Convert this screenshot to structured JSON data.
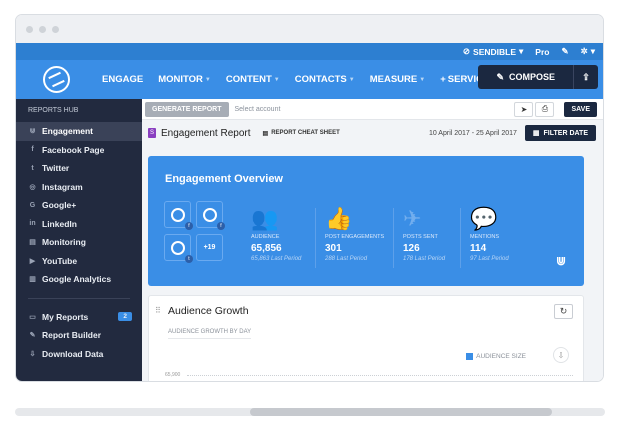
{
  "topbar": {
    "brand": "SENDIBLE",
    "plan": "Pro"
  },
  "nav": {
    "menu": [
      "ENGAGE",
      "MONITOR",
      "CONTENT",
      "CONTACTS",
      "MEASURE",
      "SERVICES"
    ],
    "compose_label": "COMPOSE"
  },
  "sidebar": {
    "heading": "REPORTS HUB",
    "items": [
      "Engagement",
      "Facebook Page",
      "Twitter",
      "Instagram",
      "Google+",
      "LinkedIn",
      "Monitoring",
      "YouTube",
      "Google Analytics"
    ],
    "bottom_items": [
      "My Reports",
      "Report Builder",
      "Download Data"
    ],
    "my_reports_count": "2"
  },
  "reportbar": {
    "generate_label": "GENERATE REPORT",
    "account_placeholder": "Select account",
    "save_label": "SAVE"
  },
  "report": {
    "title": "Engagement Report",
    "cheat_sheet": "REPORT CHEAT SHEET",
    "date_range": "10 April 2017 - 25 April 2017",
    "filter_label": "FILTER DATE"
  },
  "overview": {
    "title": "Engagement Overview",
    "more_accounts": "+19",
    "stats": [
      {
        "label": "AUDIENCE",
        "value": "65,856",
        "last": "65,863 Last Period"
      },
      {
        "label": "POST ENGAGEMENTS",
        "value": "301",
        "last": "288 Last Period"
      },
      {
        "label": "POSTS SENT",
        "value": "126",
        "last": "178 Last Period"
      },
      {
        "label": "MENTIONS",
        "value": "114",
        "last": "97 Last Period"
      }
    ]
  },
  "audience": {
    "title": "Audience Growth",
    "subtitle": "AUDIENCE GROWTH BY DAY",
    "legend": "AUDIENCE SIZE",
    "ytick": "65,900"
  },
  "colors": {
    "primary": "#3a8ee6",
    "navy": "#1b2840",
    "sidebar": "#222a3f"
  }
}
